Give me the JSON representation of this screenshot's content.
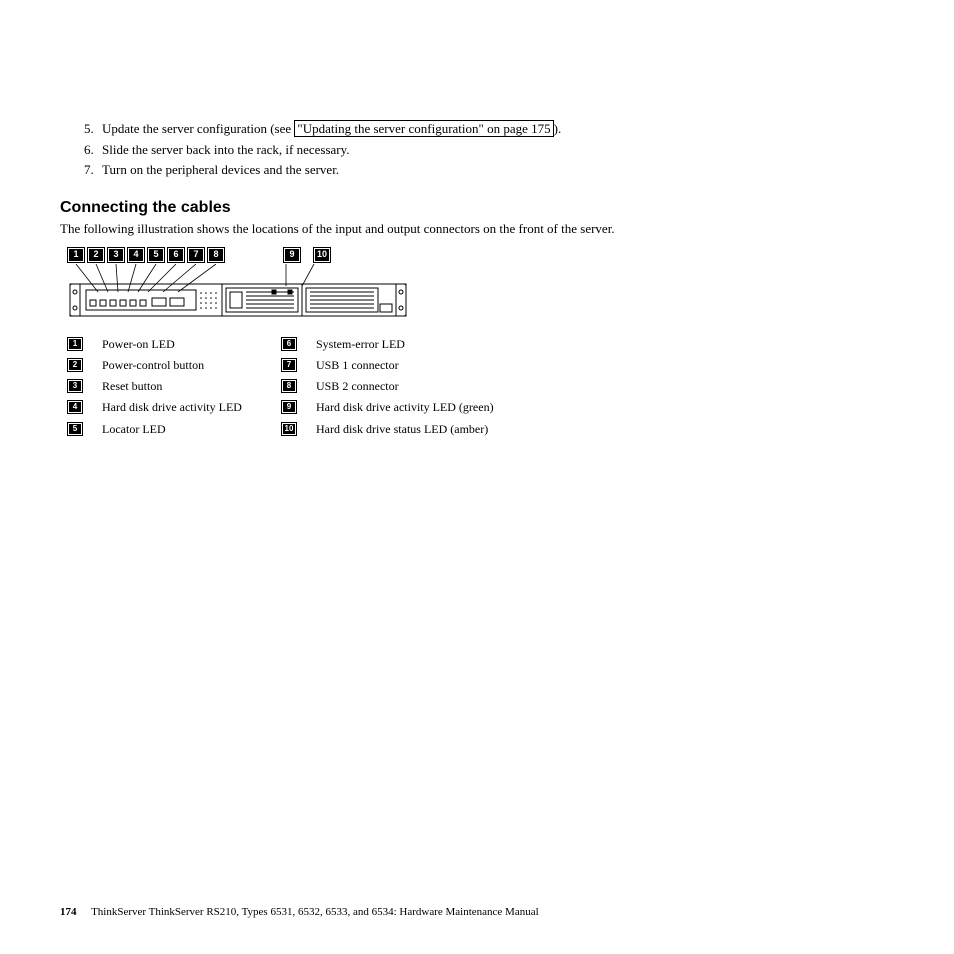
{
  "steps": [
    {
      "num": "5.",
      "before": "Update the server configuration (see ",
      "link": "\"Updating the server configuration\" on page 175",
      "after": ")."
    },
    {
      "num": "6.",
      "before": "Slide the server back into the rack, if necessary.",
      "link": "",
      "after": ""
    },
    {
      "num": "7.",
      "before": "Turn on the peripheral devices and the server.",
      "link": "",
      "after": ""
    }
  ],
  "section_title": "Connecting the cables",
  "intro": "The following illustration shows the locations of the input and output connectors on the front of the server.",
  "top_callouts_left": [
    "1",
    "2",
    "3",
    "4",
    "5",
    "6",
    "7",
    "8"
  ],
  "top_callouts_right": [
    "9",
    "10"
  ],
  "legend_left": [
    {
      "n": "1",
      "label": "Power-on LED"
    },
    {
      "n": "2",
      "label": "Power-control button"
    },
    {
      "n": "3",
      "label": "Reset button"
    },
    {
      "n": "4",
      "label": "Hard disk drive activity LED"
    },
    {
      "n": "5",
      "label": "Locator LED"
    }
  ],
  "legend_right": [
    {
      "n": "6",
      "label": "System-error LED"
    },
    {
      "n": "7",
      "label": "USB 1 connector"
    },
    {
      "n": "8",
      "label": "USB 2 connector"
    },
    {
      "n": "9",
      "label": "Hard disk drive activity LED (green)"
    },
    {
      "n": "10",
      "label": "Hard disk drive status LED (amber)"
    }
  ],
  "footer": {
    "page": "174",
    "text": "ThinkServer ThinkServer RS210, Types 6531, 6532, 6533, and 6534: Hardware Maintenance Manual"
  }
}
